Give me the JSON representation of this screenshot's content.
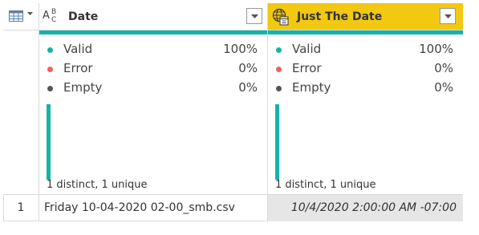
{
  "colors": {
    "selected_header": "#f2c811",
    "valid": "#12b5a6",
    "error": "#f0605d",
    "empty": "#555555",
    "selected_cell": "#e6e6e6"
  },
  "icons": {
    "table_menu": "table-icon",
    "date_type": "text-type-icon",
    "just_date_type": "globe-datetimezone-icon",
    "dropdown": "chevron-down-icon"
  },
  "columns": [
    {
      "name": "Date",
      "type_icon": "text-type-icon",
      "quality": [
        {
          "label": "Valid",
          "value": "100%"
        },
        {
          "label": "Error",
          "value": "0%"
        },
        {
          "label": "Empty",
          "value": "0%"
        }
      ],
      "distribution": "1 distinct, 1 unique"
    },
    {
      "name": "Just The Date",
      "type_icon": "globe-datetimezone-icon",
      "quality": [
        {
          "label": "Valid",
          "value": "100%"
        },
        {
          "label": "Error",
          "value": "0%"
        },
        {
          "label": "Empty",
          "value": "0%"
        }
      ],
      "distribution": "1 distinct, 1 unique"
    }
  ],
  "rows": [
    {
      "index": "1",
      "cells": [
        "Friday 10-04-2020 02-00_smb.csv",
        "10/4/2020 2:00:00 AM -07:00"
      ]
    }
  ]
}
